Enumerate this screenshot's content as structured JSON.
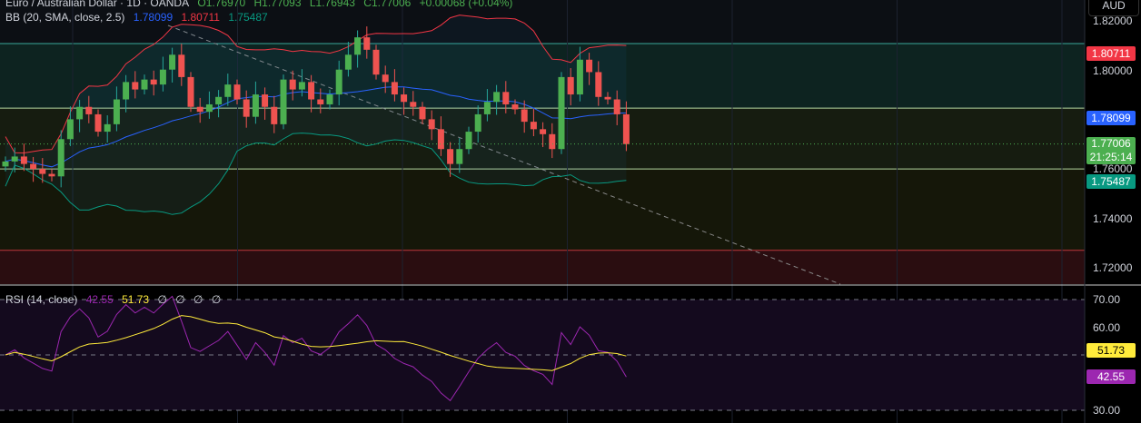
{
  "header": {
    "symbol": "Euro / Australian Dollar · 1D · OANDA",
    "o": "O1.76970",
    "h": "H1.77093",
    "l": "L1.76943",
    "c": "C1.77006",
    "chg": "+0.00068 (+0.04%)"
  },
  "bb": {
    "label": "BB (20, SMA, close, 2.5)",
    "basis": "1.78099",
    "upper": "1.80711",
    "lower": "1.75487"
  },
  "rsi": {
    "label": "RSI (14, close)",
    "value": "42.55",
    "ma": "51.73",
    "extras": [
      "∅",
      "∅",
      "∅",
      "∅"
    ]
  },
  "axis": {
    "currency": "AUD",
    "price_ticks": [
      "1.82000",
      "1.80000",
      "1.76000",
      "1.74000",
      "1.72000"
    ],
    "rsi_ticks": [
      "70.00",
      "60.00",
      "30.00"
    ],
    "last_price": "1.77006",
    "countdown": "21:25:14"
  },
  "colors": {
    "up": "#26a69a",
    "down": "#ef5350",
    "basis": "#2962ff",
    "upper": "#f23645",
    "lower": "#089981",
    "rsi": "#9c27b0",
    "rsi_ma": "#ffeb3b"
  },
  "chart_data": {
    "type": "candlestick",
    "ylim": [
      1.712,
      1.824
    ],
    "rsi_ylim": [
      25,
      78
    ],
    "levels": [
      1.8105,
      1.7845,
      1.76,
      1.7272
    ],
    "closes": [
      1.763,
      1.765,
      1.762,
      1.76,
      1.758,
      1.757,
      1.772,
      1.78,
      1.785,
      1.782,
      1.775,
      1.778,
      1.788,
      1.795,
      1.792,
      1.796,
      1.794,
      1.8,
      1.806,
      1.797,
      1.785,
      1.783,
      1.786,
      1.789,
      1.794,
      1.788,
      1.781,
      1.79,
      1.785,
      1.778,
      1.796,
      1.792,
      1.795,
      1.788,
      1.786,
      1.79,
      1.8,
      1.806,
      1.813,
      1.808,
      1.798,
      1.795,
      1.79,
      1.787,
      1.785,
      1.78,
      1.776,
      1.768,
      1.762,
      1.768,
      1.775,
      1.782,
      1.787,
      1.791,
      1.786,
      1.784,
      1.779,
      1.776,
      1.774,
      1.768,
      1.797,
      1.79,
      1.804,
      1.799,
      1.789,
      1.788,
      1.782,
      1.77
    ]
  }
}
